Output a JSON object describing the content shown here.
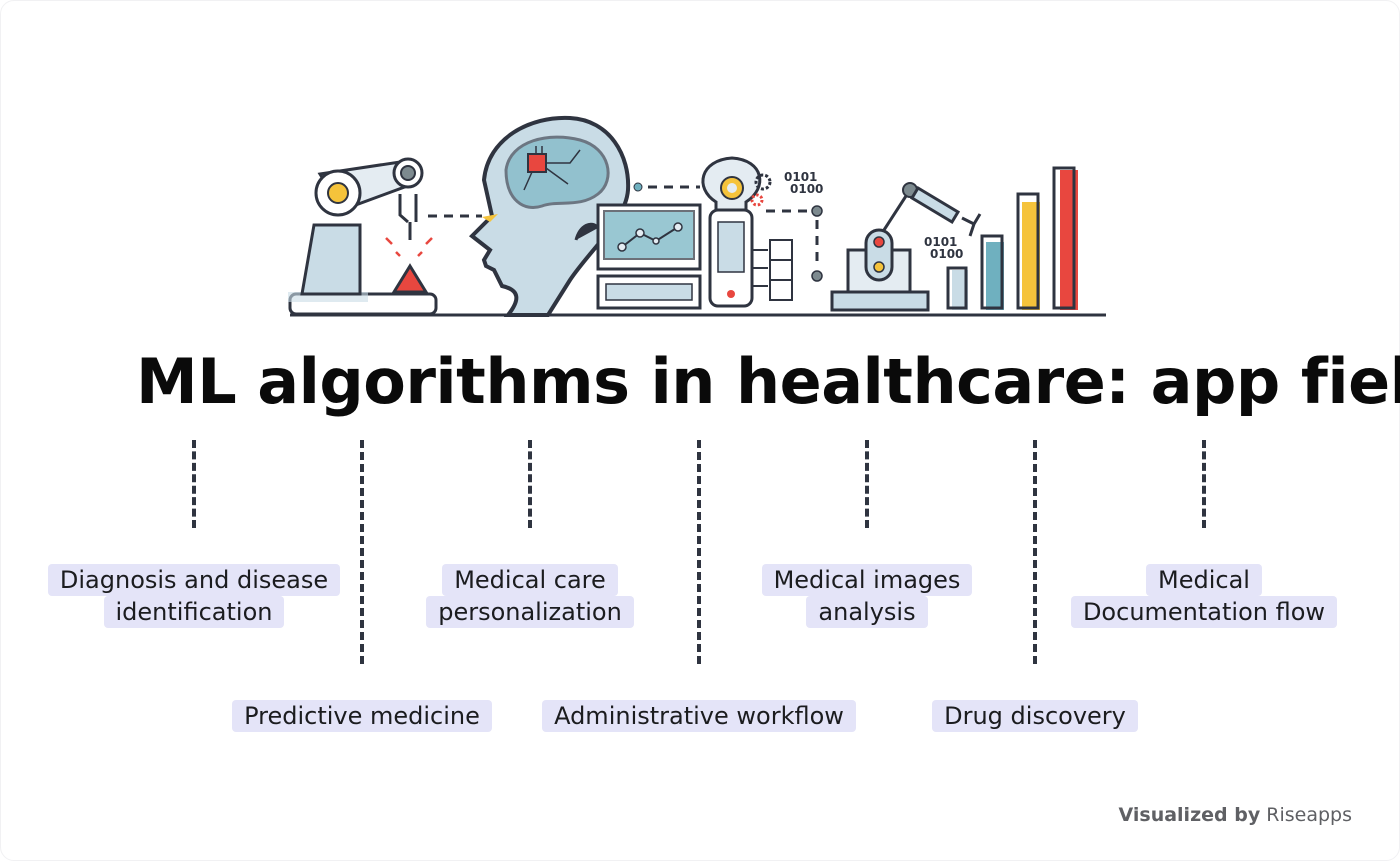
{
  "title": "ML algorithms in healthcare: app fields",
  "illustration": {
    "binary_text_1": [
      "0101",
      "0100"
    ],
    "binary_text_2": [
      "0101",
      "0100"
    ],
    "colors": {
      "outline": "#2f3440",
      "light_blue": "#c9dce6",
      "teal": "#6fb0bf",
      "red": "#e8473f",
      "yellow": "#f5c33b"
    }
  },
  "fields": [
    {
      "lines": [
        "Diagnosis and disease",
        "identification"
      ],
      "row": "top"
    },
    {
      "lines": [
        "Predictive medicine"
      ],
      "row": "bottom"
    },
    {
      "lines": [
        "Medical care",
        "personalization"
      ],
      "row": "top"
    },
    {
      "lines": [
        "Administrative workflow"
      ],
      "row": "bottom"
    },
    {
      "lines": [
        "Medical images",
        "analysis"
      ],
      "row": "top"
    },
    {
      "lines": [
        "Drug discovery"
      ],
      "row": "bottom"
    },
    {
      "lines": [
        "Medical",
        "Documentation flow"
      ],
      "row": "top"
    }
  ],
  "footer": {
    "prefix": "Visualized by",
    "brand": "Riseapps"
  },
  "colors": {
    "label_bg": "#e4e4f8",
    "connector": "#2f3440",
    "title": "#0a0a0a"
  }
}
